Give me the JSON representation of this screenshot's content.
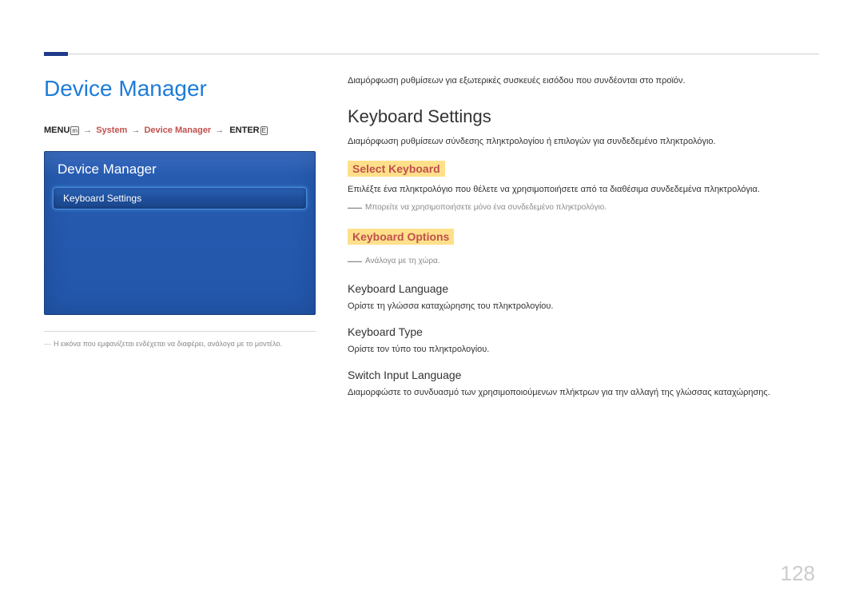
{
  "left": {
    "title": "Device Manager",
    "breadcrumb": {
      "menu": "MENU",
      "menu_glyph": "m",
      "arrow": "→",
      "system": "System",
      "device_manager": "Device Manager",
      "enter": "ENTER",
      "enter_glyph": "E"
    },
    "osd": {
      "title": "Device Manager",
      "item": "Keyboard Settings"
    },
    "note": "Η εικόνα που εμφανίζεται ενδέχεται να διαφέρει, ανάλογα με το μοντέλο."
  },
  "right": {
    "intro": "Διαμόρφωση ρυθμίσεων για εξωτερικές συσκευές εισόδου που συνδέονται στο προϊόν.",
    "h2": "Keyboard Settings",
    "h2_desc": "Διαμόρφωση ρυθμίσεων σύνδεσης πληκτρολογίου ή επιλογών για συνδεδεμένο πληκτρολόγιο.",
    "select_keyboard": {
      "title": "Select Keyboard",
      "desc": "Επιλέξτε ένα πληκτρολόγιο που θέλετε να χρησιμοποιήσετε από τα διαθέσιμα συνδεδεμένα πληκτρολόγια.",
      "note": "Μπορείτε να χρησιμοποιήσετε μόνο ένα συνδεδεμένο πληκτρολόγιο."
    },
    "keyboard_options": {
      "title": "Keyboard Options",
      "note": "Ανάλογα με τη χώρα.",
      "items": [
        {
          "title": "Keyboard Language",
          "desc": "Ορίστε τη γλώσσα καταχώρησης του πληκτρολογίου."
        },
        {
          "title": "Keyboard Type",
          "desc": "Ορίστε τον τύπο του πληκτρολογίου."
        },
        {
          "title": "Switch Input Language",
          "desc": "Διαμορφώστε το συνδυασμό των χρησιμοποιούμενων πλήκτρων για την αλλαγή της γλώσσας καταχώρησης."
        }
      ]
    }
  },
  "page_number": "128"
}
